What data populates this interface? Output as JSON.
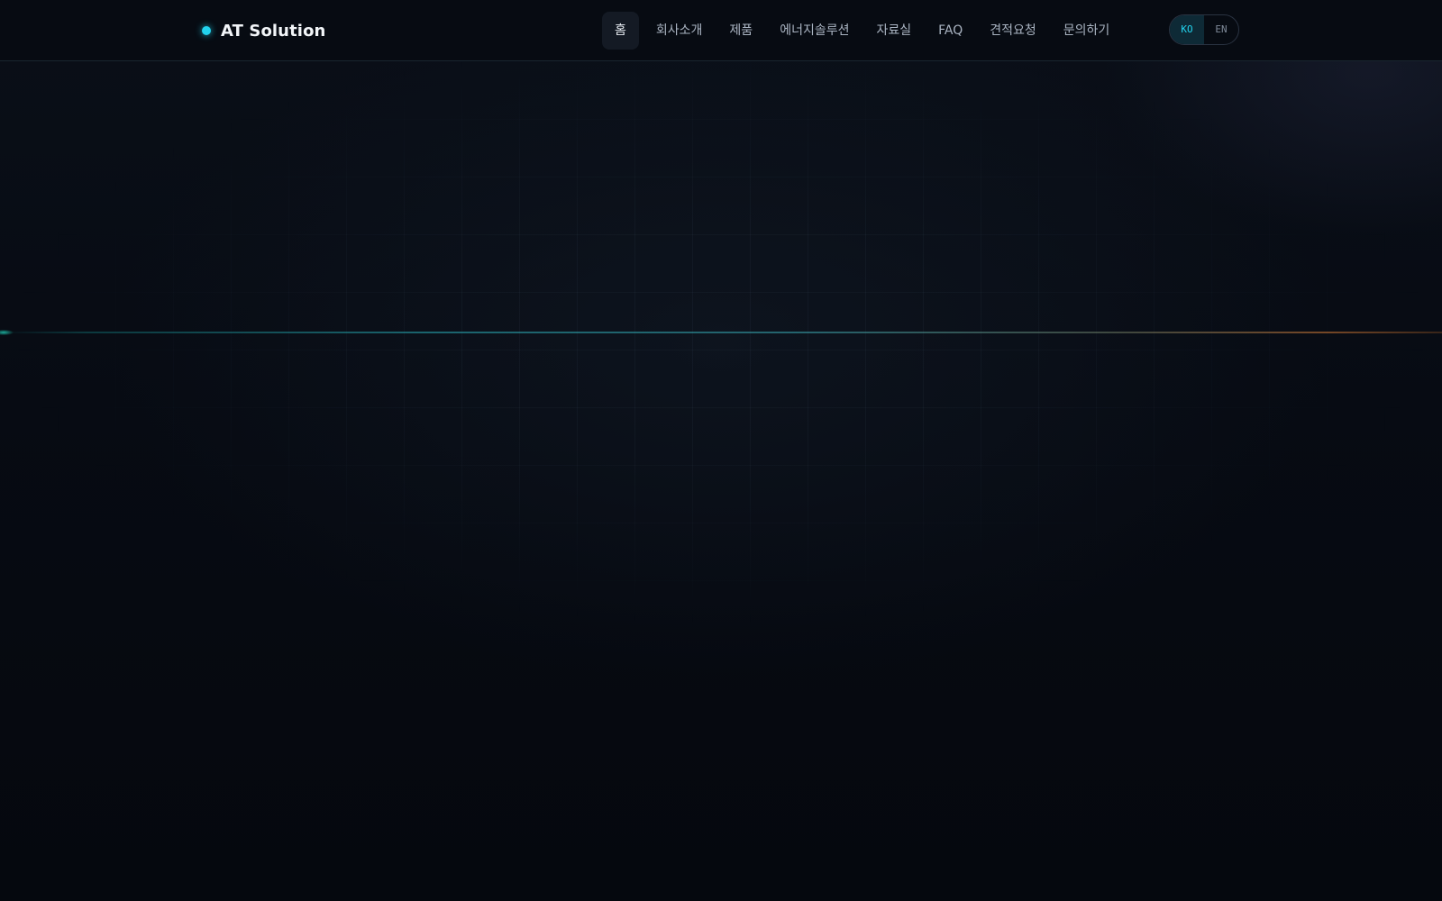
{
  "brand": {
    "name": "AT Solution",
    "accent_color": "#22d3ee"
  },
  "nav": {
    "items": [
      {
        "label": "홈",
        "active": true
      },
      {
        "label": "회사소개",
        "active": false
      },
      {
        "label": "제품",
        "active": false
      },
      {
        "label": "에너지솔루션",
        "active": false
      },
      {
        "label": "자료실",
        "active": false
      },
      {
        "label": "FAQ",
        "active": false
      },
      {
        "label": "견적요청",
        "active": false
      },
      {
        "label": "문의하기",
        "active": false
      }
    ]
  },
  "language": {
    "options": [
      "KO",
      "EN"
    ],
    "selected": "KO"
  },
  "theme": {
    "background": "#060a12",
    "beam_start_color": "#14b8a6",
    "beam_end_color": "#c2410c"
  }
}
